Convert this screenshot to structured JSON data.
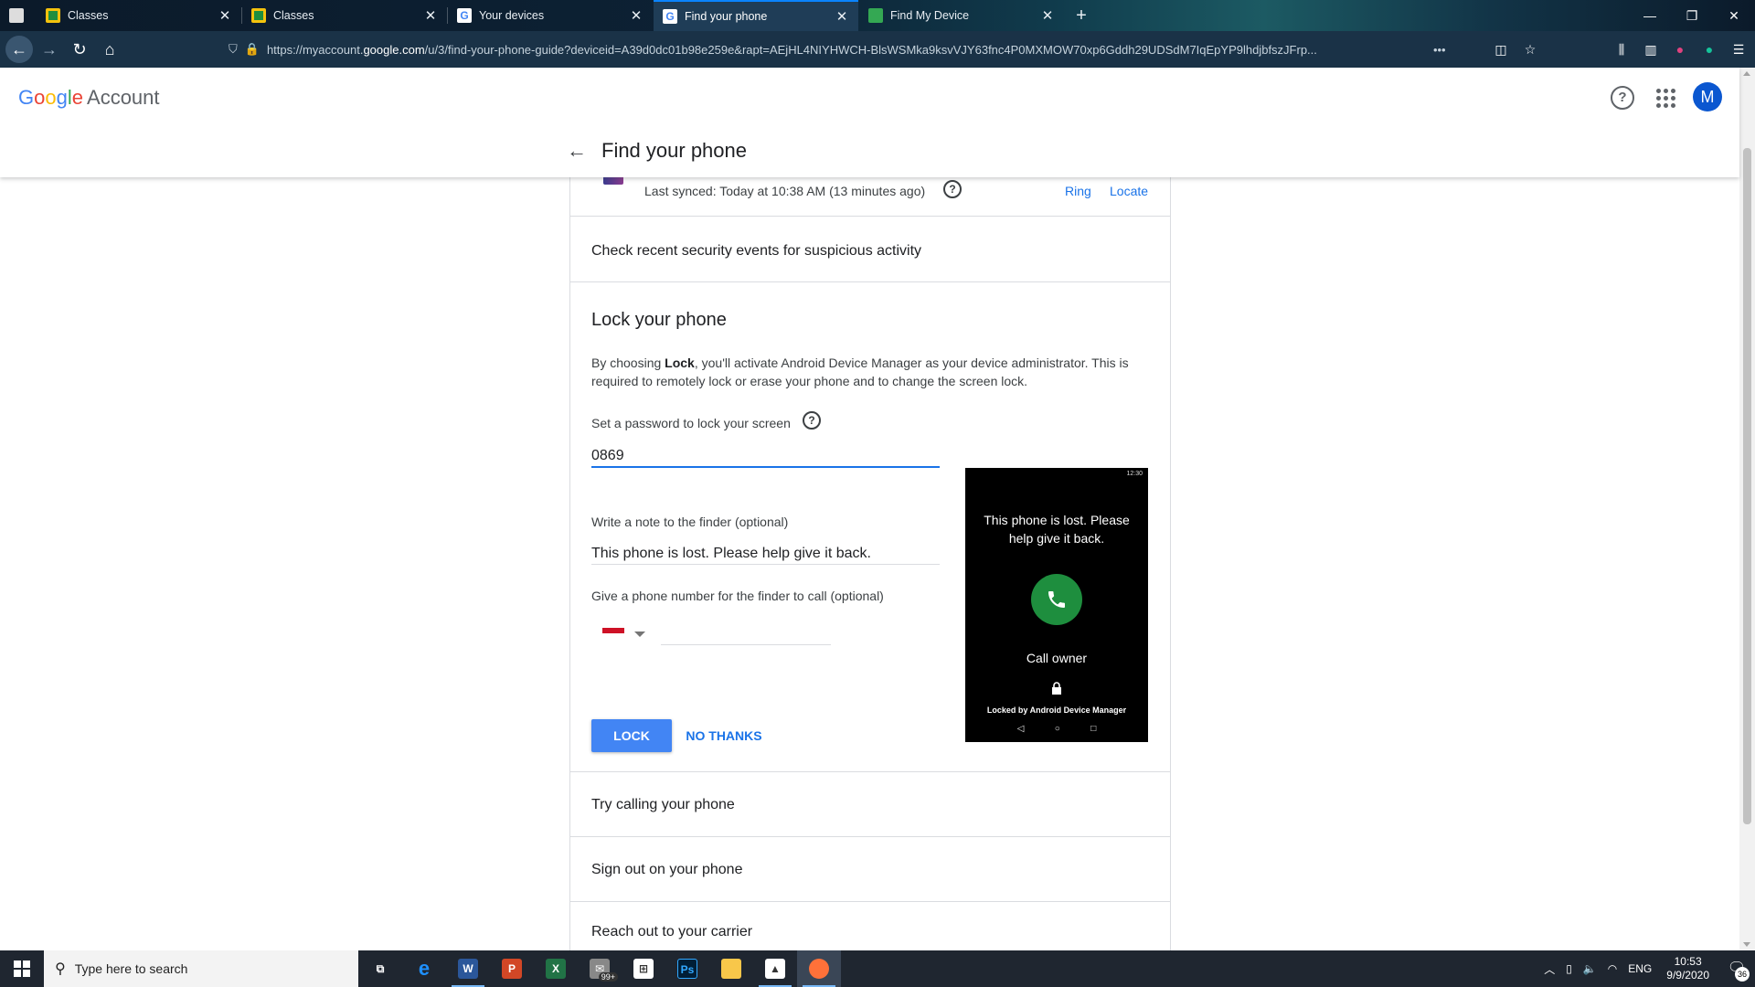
{
  "browser": {
    "tabs": [
      {
        "label": "Classes",
        "favicon": "classroom-icon",
        "active": false
      },
      {
        "label": "Classes",
        "favicon": "classroom-icon",
        "active": false
      },
      {
        "label": "Your devices",
        "favicon": "google-icon",
        "active": false
      },
      {
        "label": "Find your phone",
        "favicon": "google-icon",
        "active": true
      },
      {
        "label": "Find My Device",
        "favicon": "find-my-device-icon",
        "active": false
      }
    ],
    "url_prefix": "https://myaccount.",
    "url_host": "google.com",
    "url_path": "/u/3/find-your-phone-guide?deviceid=A39d0dc01b98e259e&rapt=AEjHL4NIYHWCH-BlsWSMka9ksvVJY63fnc4P0MXMOW70xp6Gddh29UDSdM7IqEpYP9lhdjbfszJFrp..."
  },
  "header": {
    "logo_g": "G",
    "logo_o1": "o",
    "logo_o2": "o",
    "logo_g2": "g",
    "logo_l": "l",
    "logo_e": "e",
    "account_label": "Account",
    "help_glyph": "?",
    "avatar_letter": "M",
    "back_glyph": "←",
    "page_title": "Find your phone"
  },
  "device": {
    "last_synced": "Last synced: Today at 10:38 AM (13 minutes ago)",
    "ring_label": "Ring",
    "locate_label": "Locate"
  },
  "sections": {
    "security": "Check recent security events for suspicious activity",
    "calling": "Try calling your phone",
    "signout": "Sign out on your phone",
    "carrier": "Reach out to your carrier"
  },
  "lock": {
    "heading": "Lock your phone",
    "desc_pre": "By choosing ",
    "desc_bold": "Lock",
    "desc_post": ", you'll activate Android Device Manager as your device administrator. This is required to remotely lock or erase your phone and to change the screen lock.",
    "password_label": "Set a password to lock your screen",
    "password_value": "0869",
    "note_label": "Write a note to the finder (optional)",
    "note_value": "This phone is lost. Please help give it back.",
    "phone_label": "Give a phone number for the finder to call (optional)",
    "phone_value": "",
    "lock_button": "LOCK",
    "no_thanks_button": "NO THANKS"
  },
  "preview": {
    "status_time": "12:30",
    "message": "This phone is lost. Please help give it back.",
    "call_owner": "Call owner",
    "locked_by": "Locked by Android Device Manager",
    "nav_back": "◁",
    "nav_home": "○",
    "nav_recent": "□"
  },
  "taskbar": {
    "search_placeholder": "Type here to search",
    "mail_badge": "99+",
    "language": "ENG",
    "time": "10:53",
    "date": "9/9/2020",
    "notification_count": "36"
  },
  "colors": {
    "accent_blue": "#4285f4",
    "link_blue": "#1a73e8",
    "call_green": "#1e8e3e"
  }
}
